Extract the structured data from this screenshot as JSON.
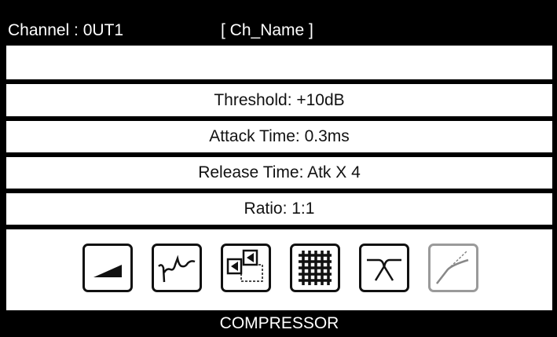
{
  "header": {
    "channel": "Channel : 0UT1",
    "name": "[ Ch_Name ]"
  },
  "params": {
    "threshold": "Threshold: +10dB",
    "attack": "Attack Time: 0.3ms",
    "release": "Release Time: Atk X 4",
    "ratio": "Ratio: 1:1"
  },
  "icons": [
    "gain-ramp-icon",
    "eq-curve-icon",
    "delay-routing-icon",
    "matrix-grid-icon",
    "crossover-filter-icon",
    "compressor-curve-icon"
  ],
  "footer": {
    "mode": "COMPRESSOR"
  },
  "colors": {
    "background": "#000000",
    "panel": "#ffffff",
    "selected_icon_border": "#9a9a9a"
  }
}
